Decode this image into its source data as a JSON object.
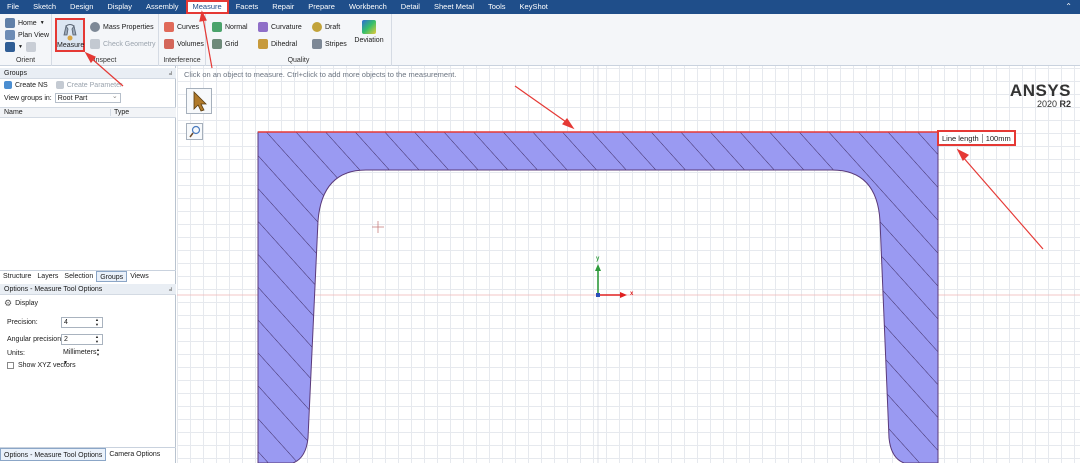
{
  "menu": {
    "items": [
      "File",
      "Sketch",
      "Design",
      "Display",
      "Assembly",
      "Measure",
      "Facets",
      "Repair",
      "Prepare",
      "Workbench",
      "Detail",
      "Sheet Metal",
      "Tools",
      "KeyShot"
    ],
    "active": "Measure"
  },
  "ribbon": {
    "orient": {
      "label": "Orient",
      "home": "Home",
      "plan_view": "Plan View"
    },
    "inspect": {
      "label": "Inspect",
      "measure": "Measure",
      "mass_properties": "Mass Properties",
      "check_geometry": "Check Geometry"
    },
    "interference": {
      "label": "Interference",
      "curves": "Curves",
      "volumes": "Volumes"
    },
    "quality": {
      "label": "Quality",
      "normal": "Normal",
      "grid": "Grid",
      "curvature": "Curvature",
      "dihedral": "Dihedral",
      "draft": "Draft",
      "stripes": "Stripes",
      "deviation": "Deviation"
    }
  },
  "groups_panel": {
    "title": "Groups",
    "create_ns": "Create NS",
    "create_parameter": "Create Parameter",
    "view_groups_label": "View groups in:",
    "view_groups_value": "Root Part",
    "col_name": "Name",
    "col_type": "Type"
  },
  "panel_tabs": [
    "Structure",
    "Layers",
    "Selection",
    "Groups",
    "Views"
  ],
  "panel_tabs_selected": "Groups",
  "options_panel": {
    "title": "Options - Measure Tool Options",
    "display": "Display",
    "precision_label": "Precision:",
    "precision_value": "4",
    "angular_label": "Angular precision:",
    "angular_value": "2",
    "units_label": "Units:",
    "units_value": "Millimeters",
    "show_xyz": "Show XYZ vectors"
  },
  "bottom_tabs": [
    "Options - Measure Tool Options",
    "Camera Options"
  ],
  "viewport": {
    "hint": "Click on an object to measure.  Ctrl+click to add more objects to the measurement.",
    "brand": "ANSYS",
    "version": "2020",
    "release": "R2",
    "axis_x": "x",
    "axis_y": "y"
  },
  "measurement": {
    "label": "Line length",
    "value": "100mm"
  },
  "colors": {
    "accent": "#1f4e8a",
    "highlight": "#e53935",
    "section_fill": "#9a9af2",
    "section_edge": "#5a3a7a"
  }
}
